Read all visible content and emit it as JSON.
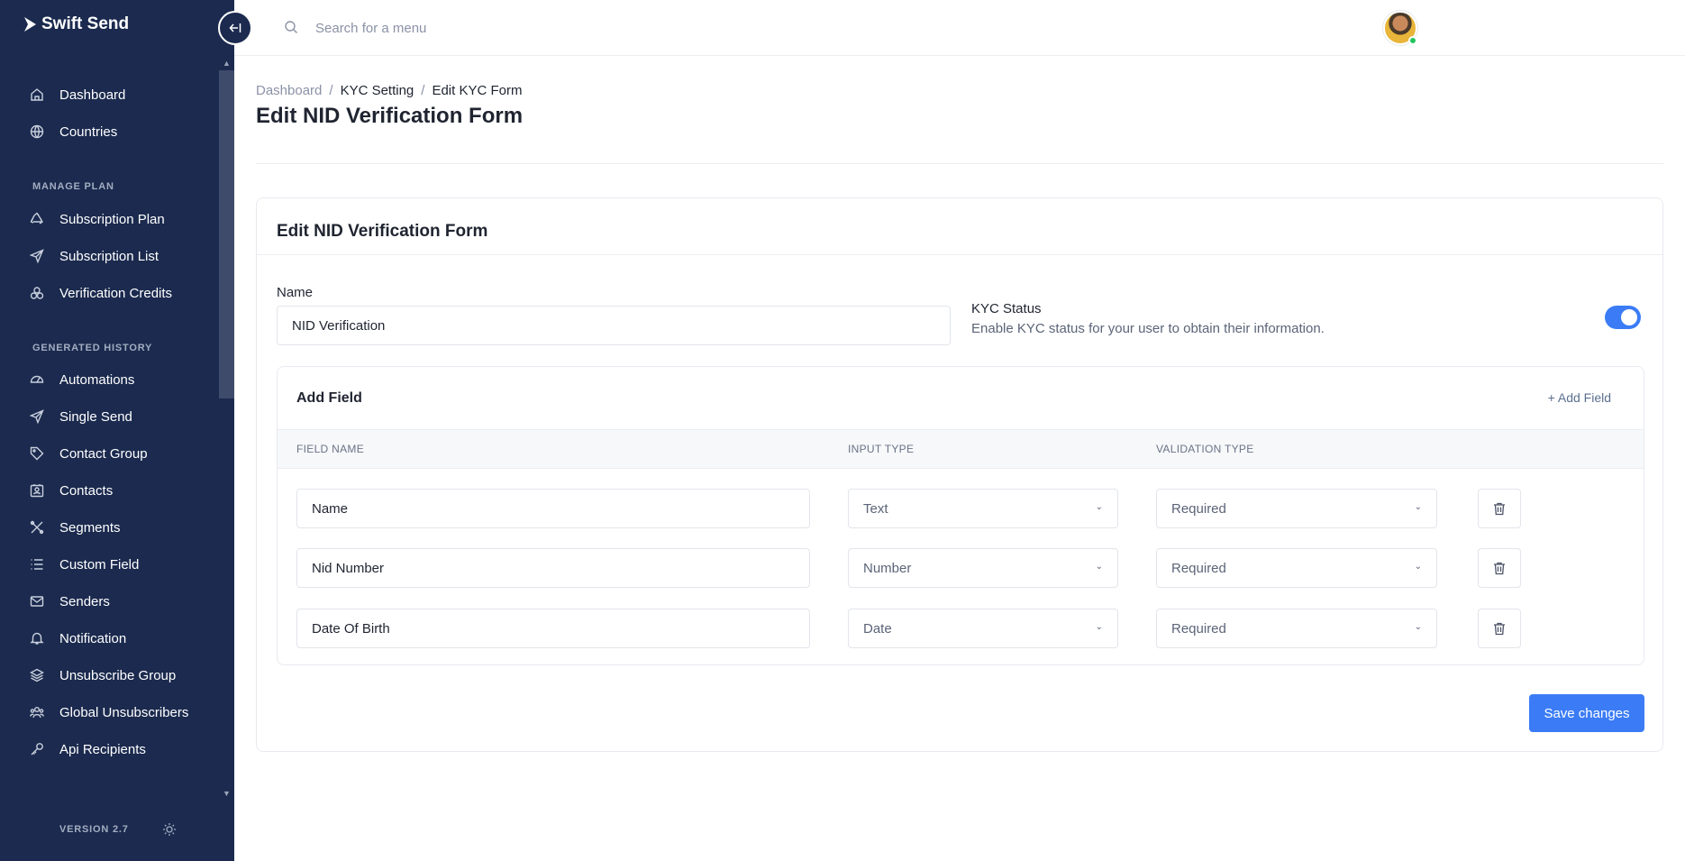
{
  "app": {
    "logo_text": "Swift Send",
    "collapse_icon": "collapse-left-icon"
  },
  "sidebar": {
    "items_top": [
      {
        "label": "Dashboard",
        "icon": "home-icon"
      },
      {
        "label": "Countries",
        "icon": "globe-icon"
      }
    ],
    "section_plan": "MANAGE PLAN",
    "items_plan": [
      {
        "label": "Subscription Plan",
        "icon": "recycle-icon"
      },
      {
        "label": "Subscription List",
        "icon": "send-icon"
      },
      {
        "label": "Verification Credits",
        "icon": "coins-icon"
      }
    ],
    "section_history": "GENERATED HISTORY",
    "items_history": [
      {
        "label": "Automations",
        "icon": "gauge-icon"
      },
      {
        "label": "Single Send",
        "icon": "send-icon"
      },
      {
        "label": "Contact Group",
        "icon": "tag-icon"
      },
      {
        "label": "Contacts",
        "icon": "contact-card-icon"
      },
      {
        "label": "Segments",
        "icon": "segments-icon"
      },
      {
        "label": "Custom Field",
        "icon": "list-icon"
      },
      {
        "label": "Senders",
        "icon": "mail-icon"
      },
      {
        "label": "Notification",
        "icon": "bell-icon"
      },
      {
        "label": "Unsubscribe Group",
        "icon": "layers-icon"
      },
      {
        "label": "Global Unsubscribers",
        "icon": "users-icon"
      },
      {
        "label": "Api Recipients",
        "icon": "key-icon"
      }
    ],
    "version": "VERSION 2.7"
  },
  "topbar": {
    "search_placeholder": "Search for a menu"
  },
  "header": {
    "breadcrumb": [
      "Dashboard",
      "KYC Setting",
      "Edit KYC Form"
    ],
    "separator": "/",
    "title": "Edit NID Verification Form"
  },
  "form": {
    "card_title": "Edit NID Verification Form",
    "name_label": "Name",
    "name_value": "NID Verification",
    "kyc_title": "KYC Status",
    "kyc_description": "Enable KYC status for your user to obtain their information.",
    "kyc_enabled": true,
    "add_field_title": "Add Field",
    "add_field_link": "+ Add Field",
    "columns": [
      "FIELD NAME",
      "INPUT TYPE",
      "VALIDATION TYPE"
    ],
    "fields": [
      {
        "name": "Name",
        "input_type": "Text",
        "validation": "Required"
      },
      {
        "name": "Nid Number",
        "input_type": "Number",
        "validation": "Required"
      },
      {
        "name": "Date Of Birth",
        "input_type": "Date",
        "validation": "Required"
      }
    ],
    "save_label": "Save changes"
  },
  "colors": {
    "sidebar_bg": "#1b2a4e",
    "accent": "#3b7cf6"
  }
}
